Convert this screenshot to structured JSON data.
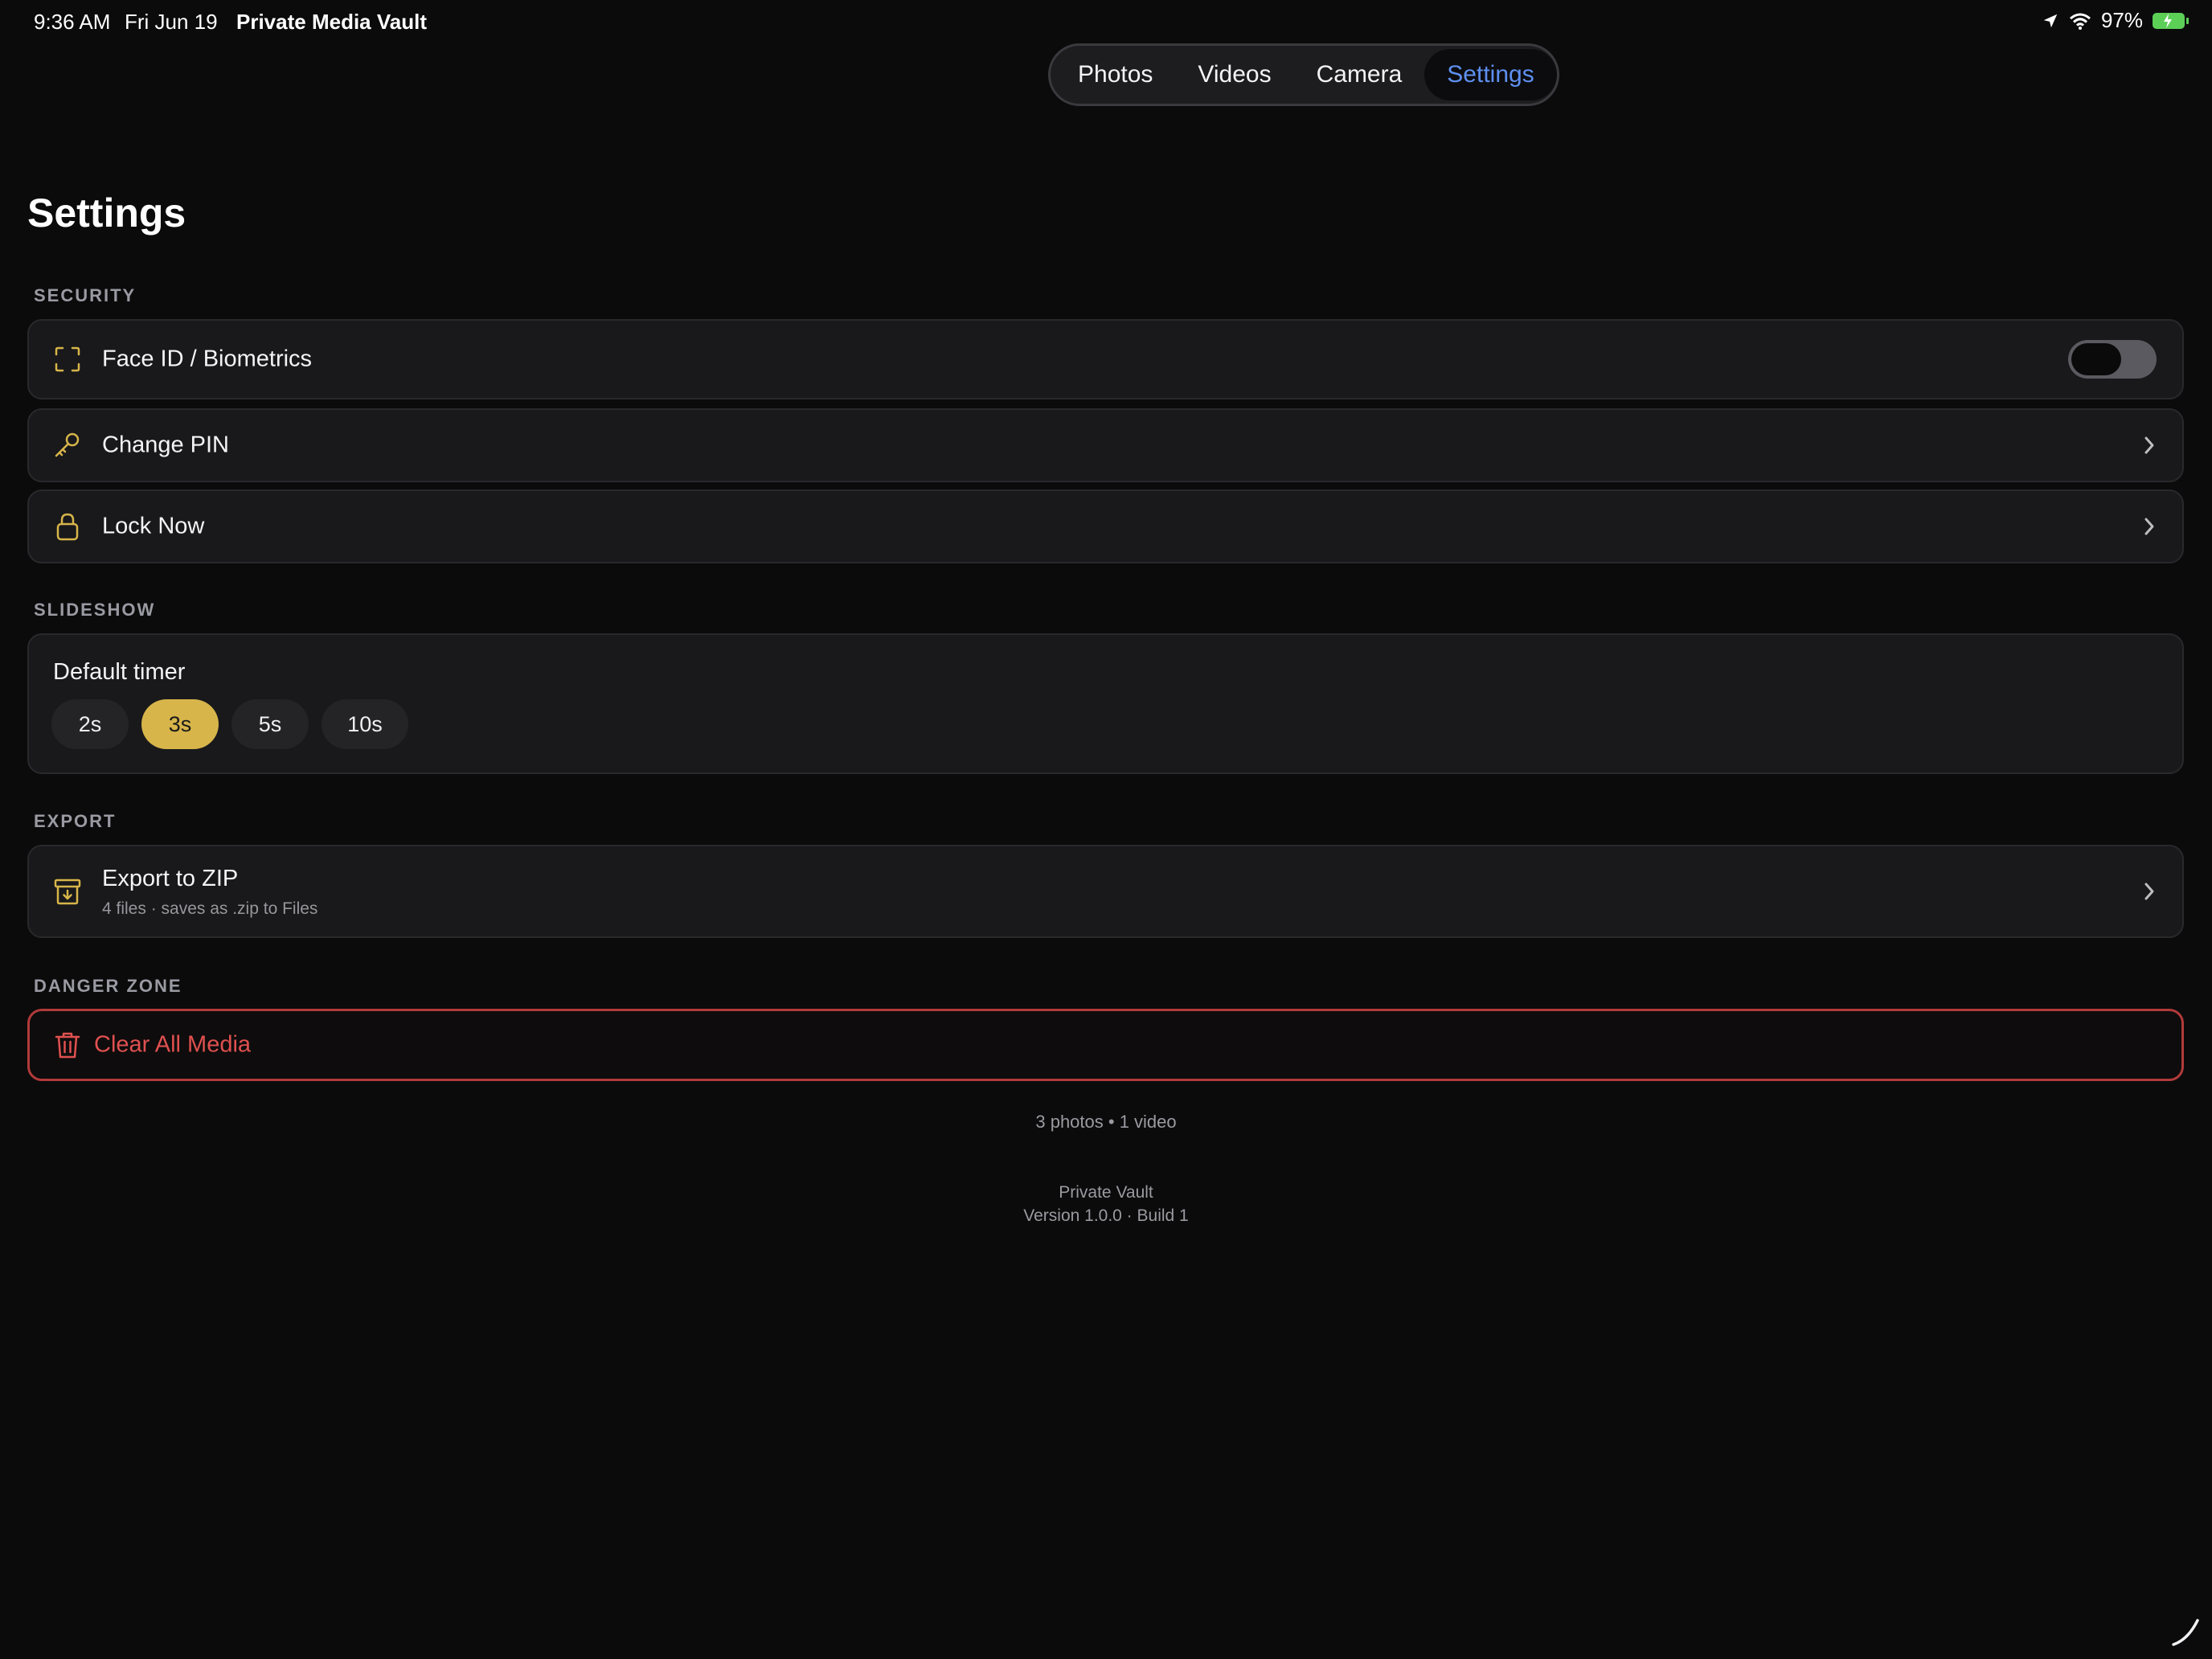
{
  "status_bar": {
    "time": "9:36 AM",
    "date": "Fri Jun 19",
    "app": "Private Media Vault",
    "battery": "97%"
  },
  "tabs": [
    {
      "label": "Photos",
      "active": false
    },
    {
      "label": "Videos",
      "active": false
    },
    {
      "label": "Camera",
      "active": false
    },
    {
      "label": "Settings",
      "active": true
    }
  ],
  "page_title": "Settings",
  "security": {
    "header": "SECURITY",
    "face_id": {
      "label": "Face ID / Biometrics",
      "icon": "face-id-icon",
      "enabled": false
    },
    "change_pin": {
      "label": "Change PIN",
      "icon": "key-icon"
    },
    "lock_now": {
      "label": "Lock Now",
      "icon": "lock-icon"
    }
  },
  "slideshow": {
    "header": "SLIDESHOW",
    "timer_label": "Default timer",
    "options": [
      "2s",
      "3s",
      "5s",
      "10s"
    ],
    "selected": "3s"
  },
  "export": {
    "header": "EXPORT",
    "label": "Export to ZIP",
    "subtitle": "4 files · saves as .zip to Files",
    "icon": "archive-icon"
  },
  "danger_zone": {
    "header": "DANGER ZONE",
    "label": "Clear All Media",
    "icon": "trash-icon"
  },
  "footer": {
    "counts": "3 photos • 1 video",
    "app_name": "Private Vault",
    "version": "Version 1.0.0 · Build 1"
  },
  "colors": {
    "accent_gold": "#d7b54a",
    "active_tab": "#5e8ff0",
    "danger": "#e05050",
    "battery": "#5ccf57"
  }
}
